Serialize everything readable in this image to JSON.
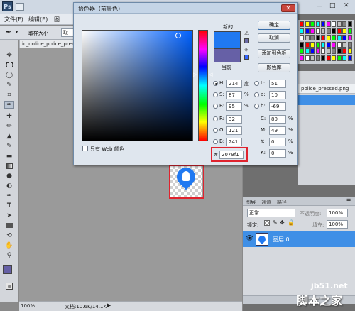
{
  "app": {
    "logo": "Ps",
    "window_controls": [
      "—",
      "□",
      "✕"
    ]
  },
  "menubar": {
    "items": [
      "文件(F)",
      "编辑(E)",
      "图"
    ]
  },
  "options_bar": {
    "sample_label": "取样大小",
    "sample_value": "取"
  },
  "document": {
    "tab_title": "ic_online_police_pressed",
    "zoom": "100%",
    "doc_info": "文档:10.6K/14.1K"
  },
  "history": {
    "item": "police_pressed.png"
  },
  "dialog": {
    "title": "拾色器（前景色）",
    "new_label": "新的",
    "current_label": "当前",
    "buttons": {
      "ok": "确定",
      "cancel": "取消",
      "add_swatch": "添加到色板",
      "libraries": "颜色库"
    },
    "web_only": "只有 Web 颜色",
    "new_color": "#2079f1",
    "current_color": "#6660a6",
    "fields": {
      "H": "214",
      "S": "87",
      "B": "95",
      "R": "32",
      "G": "121",
      "B2": "241",
      "L": "51",
      "a": "10",
      "b": "-69",
      "C": "80",
      "M": "49",
      "Y": "0",
      "K": "0"
    },
    "units": {
      "degree": "度",
      "percent": "%"
    },
    "hex_prefix": "#",
    "hex": "2079f1"
  },
  "layers": {
    "tabs": [
      "图层",
      "通道",
      "路径"
    ],
    "blend_mode": "正常",
    "opacity_label": "不透明度:",
    "opacity": "100%",
    "lock_label": "锁定:",
    "fill_label": "填充:",
    "fill": "100%",
    "layer_name": "图层 0"
  },
  "watermark": {
    "site": "jb51.net",
    "name": "脚本之家"
  },
  "colors": {
    "accent": "#2079f1",
    "selection": "#3f8fe6",
    "highlight_box": "#e0232e"
  }
}
